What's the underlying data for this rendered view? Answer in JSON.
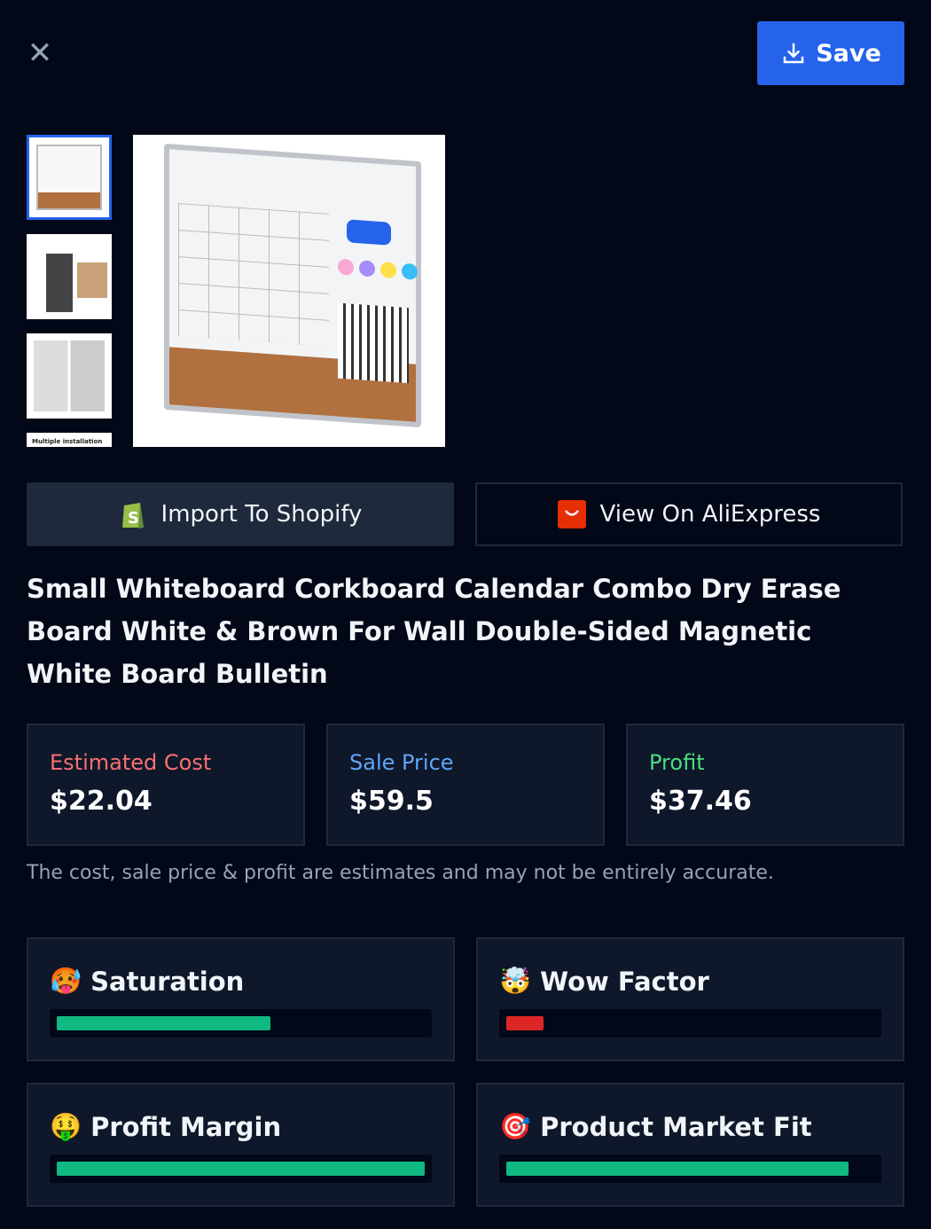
{
  "header": {
    "close_icon": "close-icon",
    "save_label": "Save",
    "save_icon": "download-icon"
  },
  "gallery": {
    "thumbnails": [
      "whiteboard-front",
      "person-with-board",
      "room-scenes",
      "Multiple installation ways"
    ],
    "selected_index": 0
  },
  "actions": {
    "import_label": "Import To Shopify",
    "view_label": "View On AliExpress"
  },
  "product": {
    "title": "Small Whiteboard Corkboard Calendar Combo Dry Erase Board White & Brown For Wall Double-Sided Magnetic White Board Bulletin"
  },
  "stats": [
    {
      "label": "Estimated Cost",
      "value": "$22.04",
      "color": "#f87171"
    },
    {
      "label": "Sale Price",
      "value": "$59.5",
      "color": "#60a5fa"
    },
    {
      "label": "Profit",
      "value": "$37.46",
      "color": "#4ade80"
    }
  ],
  "disclaimer": "The cost, sale price & profit are estimates and may not be entirely accurate.",
  "metrics": [
    {
      "emoji": "🥵",
      "label": "Saturation",
      "percent": 58,
      "color": "#10b981"
    },
    {
      "emoji": "🤯",
      "label": "Wow Factor",
      "percent": 10,
      "color": "#dc2626"
    },
    {
      "emoji": "🤑",
      "label": "Profit Margin",
      "percent": 100,
      "color": "#10b981"
    },
    {
      "emoji": "🎯",
      "label": "Product Market Fit",
      "percent": 93,
      "color": "#10b981"
    }
  ]
}
